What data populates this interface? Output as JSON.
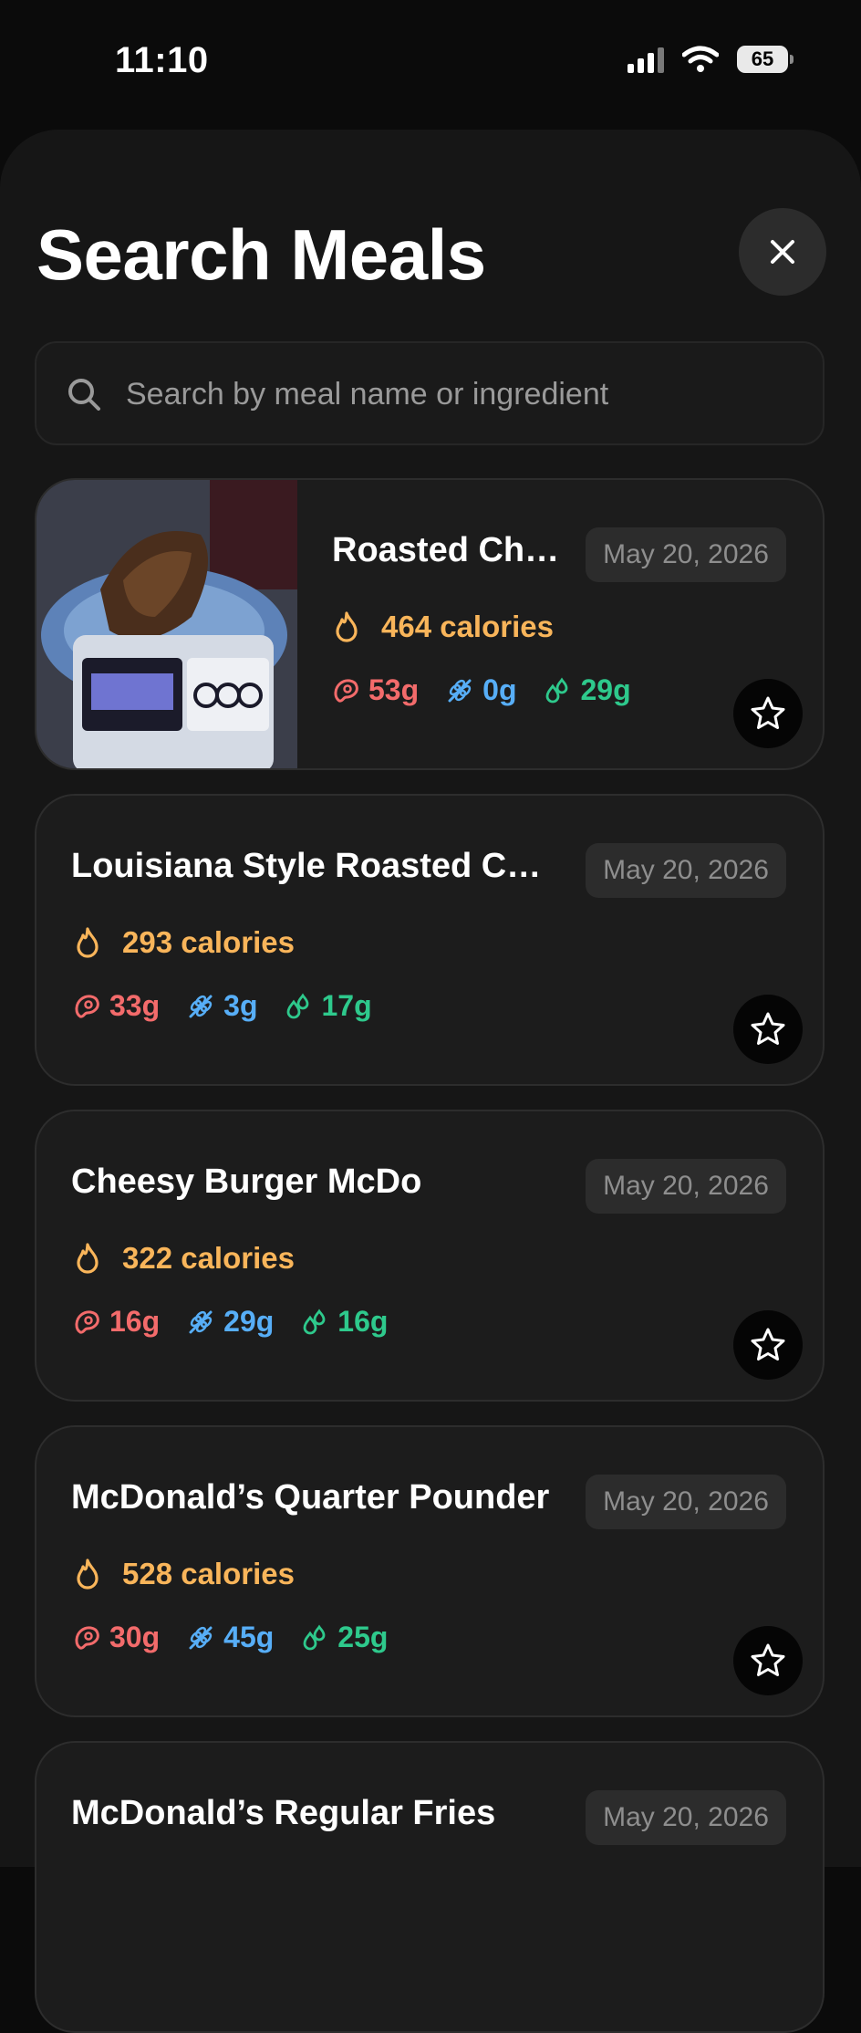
{
  "status_bar": {
    "time": "11:10",
    "battery": "65"
  },
  "header": {
    "title": "Search Meals"
  },
  "search": {
    "placeholder": "Search by meal name or ingredient"
  },
  "colors": {
    "background": "#0b0b0b",
    "sheet": "#161616",
    "card": "#1c1c1c",
    "calories": "#f9b55a",
    "protein": "#f36b6b",
    "carbs": "#57aef7",
    "fat": "#2ec98c"
  },
  "icons": {
    "close": "close-icon",
    "search": "search-icon",
    "calories": "flame-icon",
    "protein": "meat-icon",
    "carbs": "wheat-icon",
    "fat": "droplets-icon",
    "favorite": "star-icon"
  },
  "meals": [
    {
      "name": "Roasted Chi...",
      "date": "May 20, 2026",
      "calories": "464 calories",
      "protein": "53g",
      "carbs": "0g",
      "fat": "29g",
      "has_photo": true
    },
    {
      "name": "Louisiana Style Roasted Ch...",
      "date": "May 20, 2026",
      "calories": "293 calories",
      "protein": "33g",
      "carbs": "3g",
      "fat": "17g"
    },
    {
      "name": "Cheesy Burger McDo",
      "date": "May 20, 2026",
      "calories": "322 calories",
      "protein": "16g",
      "carbs": "29g",
      "fat": "16g"
    },
    {
      "name": "McDonald’s Quarter Pounder",
      "date": "May 20, 2026",
      "calories": "528 calories",
      "protein": "30g",
      "carbs": "45g",
      "fat": "25g"
    },
    {
      "name": "McDonald’s Regular Fries",
      "date": "May 20, 2026"
    }
  ]
}
